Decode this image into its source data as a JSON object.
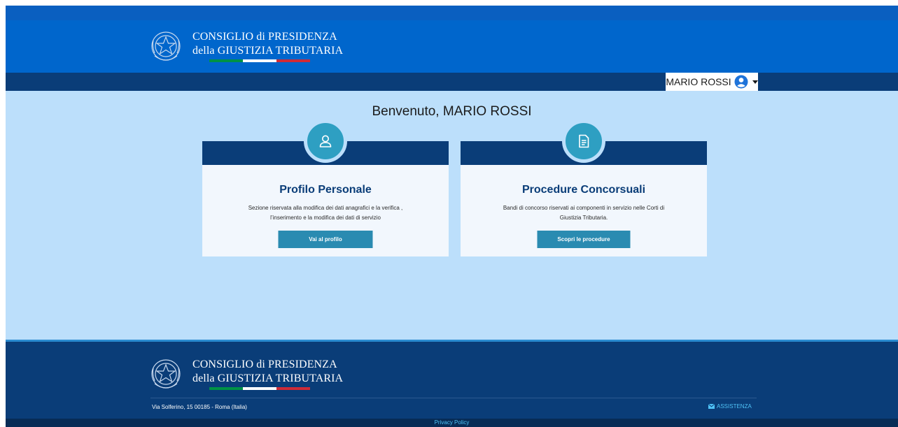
{
  "header": {
    "brand_line1": "CONSIGLIO di PRESIDENZA",
    "brand_line2": "della GIUSTIZIA TRIBUTARIA"
  },
  "user_menu": {
    "name": "MARIO ROSSI",
    "icon": "user-circle-icon"
  },
  "main": {
    "welcome": "Benvenuto, MARIO ROSSI",
    "cards": [
      {
        "icon": "user-icon",
        "title": "Profilo Personale",
        "text_line1": "Sezione riservata alla modifica dei dati anagrafici e la verifica ,",
        "text_line2": "l’inserimento e la modifica dei dati di servizio",
        "button": "Vai al profilo"
      },
      {
        "icon": "document-icon",
        "title": "Procedure Concorsuali",
        "text_line1": "Bandi di concorso riservati ai componenti in servizio nelle Corti di",
        "text_line2": "Giustizia Tributaria.",
        "button": "Scopri le procedure"
      }
    ]
  },
  "footer": {
    "brand_line1": "CONSIGLIO di PRESIDENZA",
    "brand_line2": "della GIUSTIZIA TRIBUTARIA",
    "address": "Via Solferino, 15 00185 - Roma (Italia)",
    "assist_icon": "envelope-icon",
    "assist_label": "ASSISTENZA",
    "privacy": "Privacy Policy"
  },
  "colors": {
    "header_blue": "#0066cc",
    "navy": "#0a3d78",
    "page_bg": "#bcdffb",
    "accent_teal": "#2a8bb1",
    "link_cyan": "#4fc3f7"
  }
}
